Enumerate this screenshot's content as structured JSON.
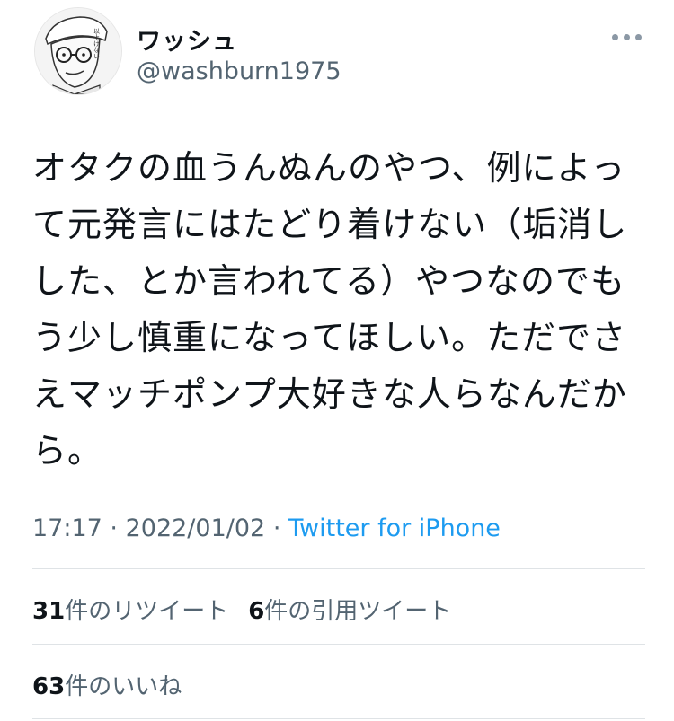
{
  "user": {
    "display_name": "ワッシュ",
    "handle": "@washburn1975",
    "avatar_text": "以上けない"
  },
  "tweet": {
    "text": "オタクの血うんぬんのやつ、例によって元発言にはたどり着けない（垢消しした、とか言われてる）やつなのでもう少し慎重になってほしい。ただでさえマッチポンプ大好きな人らなんだから。",
    "time": "17:17",
    "sep1": "·",
    "date": "2022/01/02",
    "sep2": "·",
    "source": "Twitter for iPhone"
  },
  "stats": {
    "retweets_count": "31",
    "retweets_label": "件のリツイート",
    "quotes_count": "6",
    "quotes_label": "件の引用ツイート",
    "likes_count": "63",
    "likes_label": "件のいいね"
  },
  "colors": {
    "text": "#0f1419",
    "muted": "#536471",
    "link": "#1d9bf0",
    "divider": "#dfe3e6"
  },
  "icons": {
    "more": "more-dots-icon"
  }
}
